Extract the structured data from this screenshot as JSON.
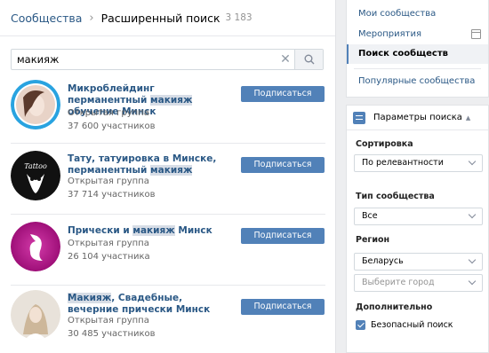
{
  "header": {
    "breadcrumb_root": "Сообщества",
    "breadcrumb_sep": "›",
    "title": "Расширенный поиск",
    "count": "3 183"
  },
  "search": {
    "value": "макияж",
    "placeholder": ""
  },
  "results": [
    {
      "title_before": "Микроблейдинг перманентный ",
      "title_highlight": "макияж",
      "title_after": " обучение Минск",
      "type": "Открытая группа",
      "members": "37 600 участников",
      "button": "Подписаться",
      "avatar_colors": [
        "#29a3e0",
        "#e8d3c7"
      ]
    },
    {
      "title_before": "Тату, татуировка в Минске, перманентный ",
      "title_highlight": "макияж",
      "title_after": "",
      "type": "Открытая группа",
      "members": "37 714 участников",
      "button": "Подписаться",
      "avatar_colors": [
        "#111111",
        "#ffffff"
      ]
    },
    {
      "title_before": "Прически и ",
      "title_highlight": "макияж",
      "title_after": " Минск",
      "type": "Открытая группа",
      "members": "26 104 участника",
      "button": "Подписаться",
      "avatar_colors": [
        "#b5198b",
        "#ffffff"
      ]
    },
    {
      "title_before": "",
      "title_highlight": "Макияж",
      "title_after": ", Свадебные, вечерние прически Минск",
      "type": "Открытая группа",
      "members": "30 485 участников",
      "button": "Подписаться",
      "avatar_colors": [
        "#c9c2bb",
        "#f3efe9"
      ]
    }
  ],
  "nav": {
    "my_communities": "Мои сообщества",
    "events": "Мероприятия",
    "community_search": "Поиск сообществ",
    "popular": "Популярные сообщества"
  },
  "filters": {
    "title": "Параметры поиска",
    "sort_label": "Сортировка",
    "sort_value": "По релевантности",
    "type_label": "Тип сообщества",
    "type_value": "Все",
    "region_label": "Регион",
    "country_value": "Беларусь",
    "city_placeholder": "Выберите город",
    "extra_label": "Дополнительно",
    "safe_search_label": "Безопасный поиск",
    "safe_search_checked": true
  },
  "colors": {
    "accent": "#5181b8",
    "link": "#2a5885",
    "highlight": "#d7dde6"
  }
}
